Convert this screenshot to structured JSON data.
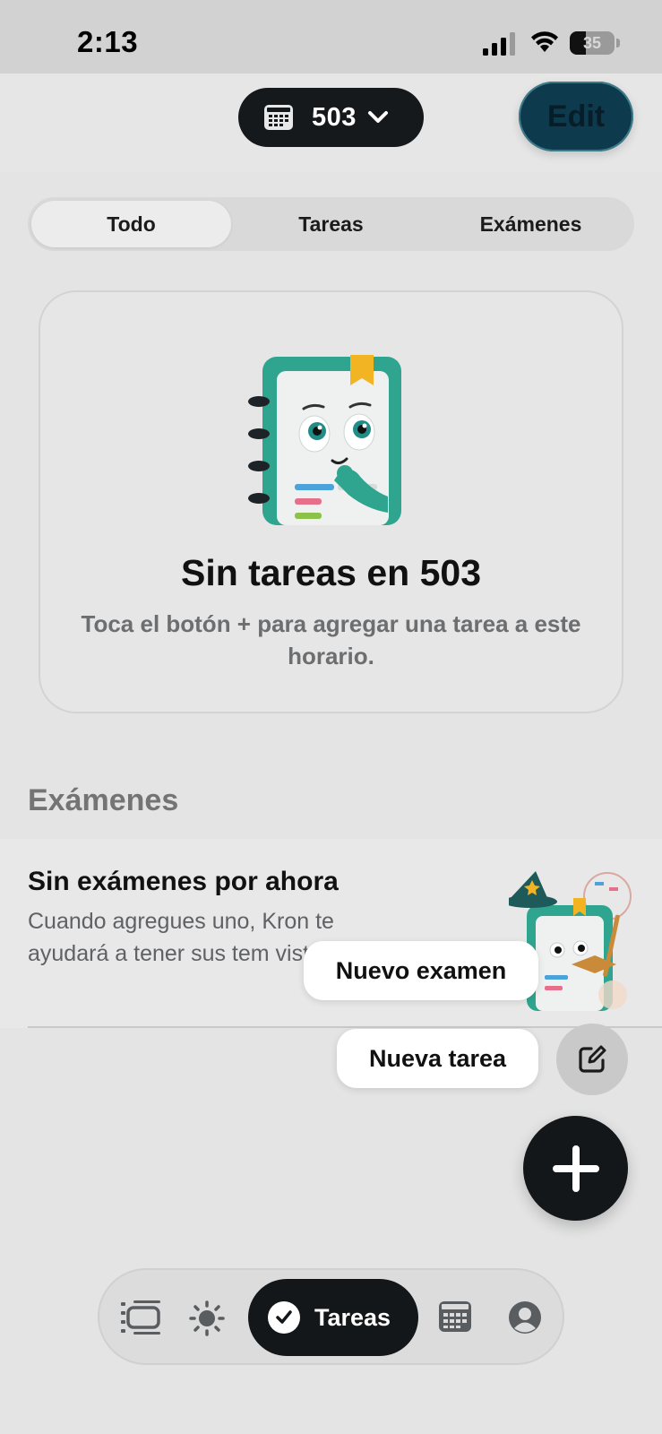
{
  "status_bar": {
    "time": "2:13",
    "battery": "35",
    "battery_level": 0.35
  },
  "header": {
    "schedule_name": "503",
    "edit_label": "Edit"
  },
  "tabs": [
    {
      "label": "Todo",
      "active": true
    },
    {
      "label": "Tareas",
      "active": false
    },
    {
      "label": "Exámenes",
      "active": false
    }
  ],
  "empty_tasks": {
    "title": "Sin tareas en 503",
    "subtitle": "Toca el botón + para agregar una tarea a este horario."
  },
  "exams": {
    "heading": "Exámenes",
    "empty_title": "Sin exámenes por ahora",
    "empty_subtitle_visible": "Cuando agregues uno, Kron te ayudará a tener sus tem vista."
  },
  "fab_menu": {
    "new_exam": "Nuevo examen",
    "new_task": "Nueva tarea"
  },
  "bottom_nav": {
    "items": [
      {
        "icon": "timeline-icon"
      },
      {
        "icon": "sun-icon"
      },
      {
        "icon": "check-circle-icon",
        "label": "Tareas",
        "active": true
      },
      {
        "icon": "calendar-icon"
      },
      {
        "icon": "profile-icon"
      }
    ]
  },
  "colors": {
    "accent_teal": "#2fa58f",
    "dark": "#131719",
    "edit_button": "#0e3a4d"
  }
}
